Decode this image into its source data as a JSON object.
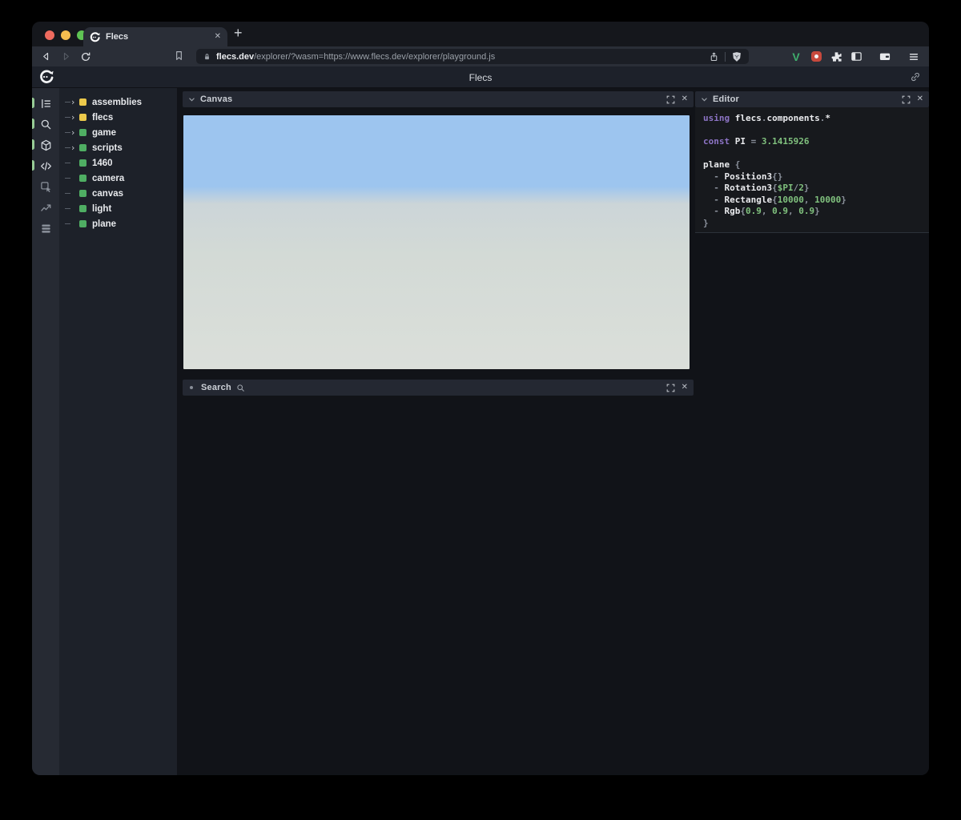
{
  "browser": {
    "tab": {
      "title": "Flecs",
      "close_glyph": "✕"
    },
    "new_tab_glyph": "+",
    "url": {
      "domain": "flecs.dev",
      "path": "/explorer/?wasm=https://www.flecs.dev/explorer/playground.js"
    },
    "icons": [
      "back-icon",
      "forward-icon",
      "reload-icon",
      "bookmark-icon",
      "lock-icon",
      "share-icon",
      "brave-shield-icon",
      "vue-devtools-icon",
      "blocker-icon",
      "extensions-puzzle-icon",
      "sidebar-icon",
      "wallet-icon",
      "menu-icon"
    ],
    "vue_label": "V"
  },
  "app": {
    "header": {
      "title": "Flecs",
      "logo": "flecs-logo",
      "link_icon": "link-icon"
    },
    "rail": {
      "items": [
        {
          "name": "entity-tree-icon",
          "active": true
        },
        {
          "name": "search-icon",
          "active": true
        },
        {
          "name": "entities-cube-icon",
          "active": true
        },
        {
          "name": "code-editor-icon",
          "active": true
        },
        {
          "name": "inspector-icon",
          "active": false
        },
        {
          "name": "stats-chart-icon",
          "active": false
        },
        {
          "name": "requests-stack-icon",
          "active": false
        }
      ]
    },
    "tree": {
      "items": [
        {
          "label": "assemblies",
          "color": "yellow",
          "expandable": true
        },
        {
          "label": "flecs",
          "color": "yellow",
          "expandable": true
        },
        {
          "label": "game",
          "color": "green",
          "expandable": true
        },
        {
          "label": "scripts",
          "color": "green",
          "expandable": true
        },
        {
          "label": "1460",
          "color": "green",
          "expandable": false
        },
        {
          "label": "camera",
          "color": "green",
          "expandable": false
        },
        {
          "label": "canvas",
          "color": "green",
          "expandable": false
        },
        {
          "label": "light",
          "color": "green",
          "expandable": false
        },
        {
          "label": "plane",
          "color": "green",
          "expandable": false
        }
      ]
    },
    "panels": {
      "canvas": {
        "title": "Canvas",
        "sky_color": "#9dc5ef",
        "horizon_color": "#ccd5d8",
        "ground_color": "#d3dad6",
        "ground_bottom_color": "#dbdfda"
      },
      "search": {
        "title": "Search"
      },
      "editor": {
        "title": "Editor",
        "code_lines": [
          [
            [
              "kw",
              "using"
            ],
            [
              "pu",
              " "
            ],
            [
              "id",
              "flecs"
            ],
            [
              "pu",
              "."
            ],
            [
              "id",
              "components"
            ],
            [
              "pu",
              "."
            ],
            [
              "id",
              "*"
            ]
          ],
          [],
          [
            [
              "kw",
              "const"
            ],
            [
              "pu",
              " "
            ],
            [
              "id",
              "PI"
            ],
            [
              "pu",
              " = "
            ],
            [
              "nu",
              "3.1415926"
            ]
          ],
          [],
          [
            [
              "id",
              "plane"
            ],
            [
              "pu",
              " {"
            ]
          ],
          [
            [
              "pu",
              "  - "
            ],
            [
              "id",
              "Position3"
            ],
            [
              "pu",
              "{}"
            ]
          ],
          [
            [
              "pu",
              "  - "
            ],
            [
              "id",
              "Rotation3"
            ],
            [
              "pu",
              "{"
            ],
            [
              "nu",
              "$PI"
            ],
            [
              "pu",
              "/"
            ],
            [
              "nu",
              "2"
            ],
            [
              "pu",
              "}"
            ]
          ],
          [
            [
              "pu",
              "  - "
            ],
            [
              "id",
              "Rectangle"
            ],
            [
              "pu",
              "{"
            ],
            [
              "nu",
              "10000"
            ],
            [
              "pu",
              ", "
            ],
            [
              "nu",
              "10000"
            ],
            [
              "pu",
              "}"
            ]
          ],
          [
            [
              "pu",
              "  - "
            ],
            [
              "id",
              "Rgb"
            ],
            [
              "pu",
              "{"
            ],
            [
              "nu",
              "0.9"
            ],
            [
              "pu",
              ", "
            ],
            [
              "nu",
              "0.9"
            ],
            [
              "pu",
              ", "
            ],
            [
              "nu",
              "0.9"
            ],
            [
              "pu",
              "}"
            ]
          ],
          [
            [
              "pu",
              "}"
            ]
          ]
        ]
      }
    }
  },
  "colors": {
    "entity_yellow": "#ecc94b",
    "entity_green": "#4fae63",
    "rail_pill_green": "#97cc96",
    "traffic_red": "#ee6a5e",
    "traffic_yellow": "#f5bd4f",
    "traffic_green": "#5fc454",
    "accent_purple": "#8d74c6",
    "accent_number_green": "#80c17e"
  }
}
